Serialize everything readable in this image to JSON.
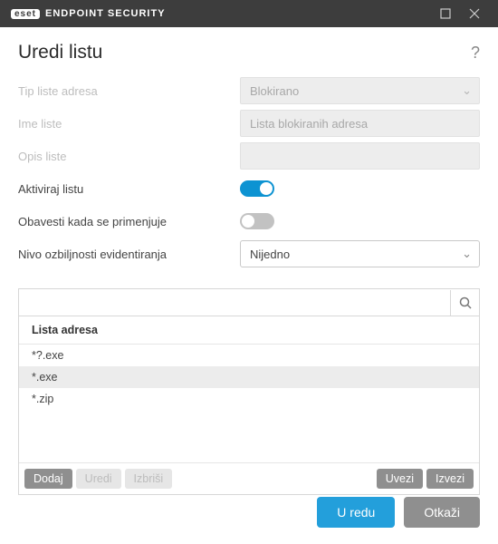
{
  "titlebar": {
    "brand_badge": "eset",
    "brand_text": "ENDPOINT SECURITY"
  },
  "heading": "Uredi listu",
  "help_glyph": "?",
  "form": {
    "tip_label": "Tip liste adresa",
    "tip_value": "Blokirano",
    "ime_label": "Ime liste",
    "ime_value": "Lista blokiranih adresa",
    "opis_label": "Opis liste",
    "opis_value": "",
    "aktiviraj_label": "Aktiviraj listu",
    "aktiviraj_on": true,
    "obavesti_label": "Obavesti kada se primenjuje",
    "obavesti_on": false,
    "nivo_label": "Nivo ozbiljnosti evidentiranja",
    "nivo_value": "Nijedno"
  },
  "list": {
    "header": "Lista adresa",
    "items": [
      {
        "text": "*?.exe",
        "selected": false
      },
      {
        "text": "*.exe",
        "selected": true
      },
      {
        "text": "*.zip",
        "selected": false
      }
    ],
    "actions": {
      "dodaj": "Dodaj",
      "uredi": "Uredi",
      "izbrisi": "Izbriši",
      "uvezi": "Uvezi",
      "izvezi": "Izvezi"
    }
  },
  "footer": {
    "ok": "U redu",
    "cancel": "Otkaži"
  }
}
